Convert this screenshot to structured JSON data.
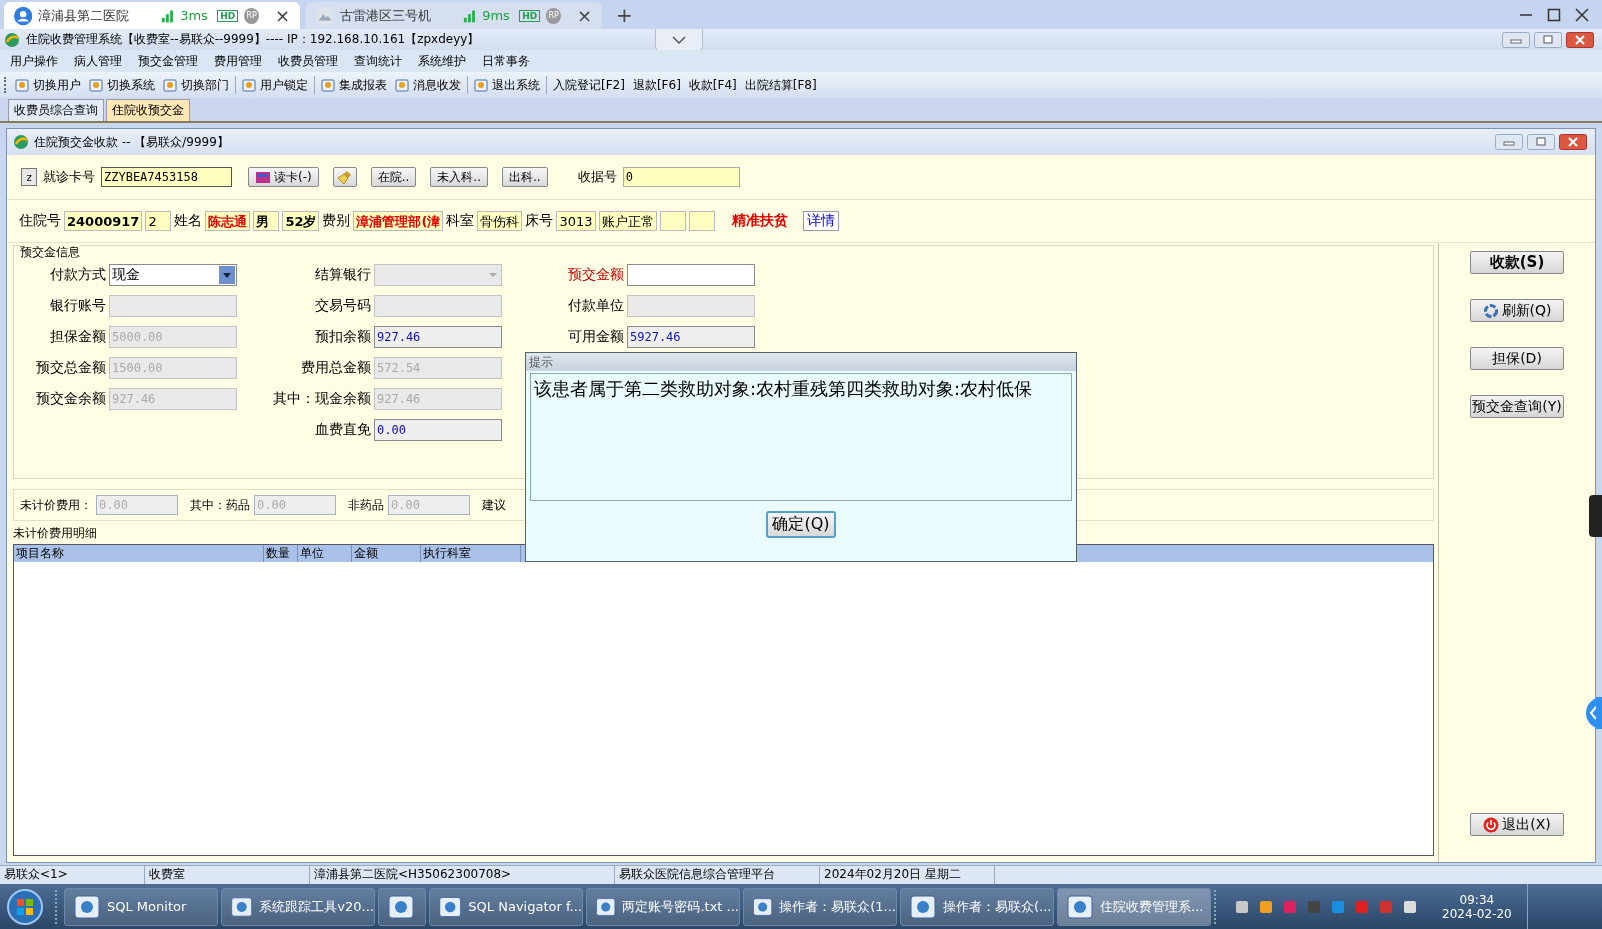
{
  "remote_tabs": [
    {
      "title": "漳浦县第二医院",
      "latency": "3ms",
      "badges": [
        "HD",
        "RP"
      ],
      "close": "×",
      "selected": true
    },
    {
      "title": "古雷港区三号机",
      "latency": "9ms",
      "badges": [
        "HD",
        "RP"
      ],
      "close": "×",
      "selected": false
    }
  ],
  "new_tab": "+",
  "app_title": "住院收费管理系统【收费室--易联众--9999】---- IP：192.168.10.161【zpxdeyy】",
  "menu": [
    "用户操作",
    "病人管理",
    "预交金管理",
    "费用管理",
    "收费员管理",
    "查询统计",
    "系统维护",
    "日常事务"
  ],
  "toolbar": [
    {
      "label": "切换用户",
      "kind": "icon"
    },
    {
      "label": "切换系统",
      "kind": "icon"
    },
    {
      "label": "切换部门",
      "kind": "icon"
    },
    {
      "label": "用户锁定",
      "kind": "icon"
    },
    {
      "label": "集成报表",
      "kind": "icon"
    },
    {
      "label": "消息收发",
      "kind": "icon"
    },
    {
      "label": "退出系统",
      "kind": "icon"
    },
    {
      "label": "入院登记[F2]",
      "kind": "text"
    },
    {
      "label": "退款[F6]",
      "kind": "text"
    },
    {
      "label": "收款[F4]",
      "kind": "text"
    },
    {
      "label": "出院结算[F8]",
      "kind": "text"
    }
  ],
  "doc_tabs": [
    {
      "label": "收费员综合查询",
      "selected": false
    },
    {
      "label": "住院收预交金",
      "selected": true
    }
  ],
  "window": {
    "title": "住院预交金收款 -- 【易联众/9999】"
  },
  "card_row": {
    "z_button": "z",
    "card_label": "就诊卡号",
    "card_value": "ZZYBEA7453158",
    "read_button": "读卡(-)",
    "buttons": [
      "在院..",
      "未入科..",
      "出科.."
    ],
    "receipt_label": "收据号",
    "receipt_value": "0"
  },
  "patient_row": [
    {
      "kind": "label",
      "text": "住院号"
    },
    {
      "kind": "field",
      "text": "24000917",
      "bold": true,
      "highlight": false
    },
    {
      "kind": "field",
      "text": "2",
      "bold": false,
      "highlight": false
    },
    {
      "kind": "label",
      "text": "姓名"
    },
    {
      "kind": "field",
      "text": "陈志通",
      "bold": true,
      "highlight": true
    },
    {
      "kind": "field",
      "text": "男",
      "bold": true,
      "highlight": false
    },
    {
      "kind": "field",
      "text": "52岁",
      "bold": true,
      "highlight": false
    },
    {
      "kind": "label",
      "text": "费别"
    },
    {
      "kind": "field",
      "text": "漳浦管理部(湋",
      "bold": true,
      "highlight": true
    },
    {
      "kind": "label",
      "text": "科室"
    },
    {
      "kind": "field",
      "text": "骨伤科",
      "bold": false,
      "highlight": false
    },
    {
      "kind": "label",
      "text": "床号"
    },
    {
      "kind": "field",
      "text": "3013",
      "bold": false,
      "highlight": false
    },
    {
      "kind": "field",
      "text": "账户正常",
      "bold": false,
      "highlight": false
    },
    {
      "kind": "field"
    },
    {
      "kind": "field"
    },
    {
      "kind": "alert",
      "text": "精准扶贫"
    },
    {
      "kind": "link",
      "text": "详情"
    }
  ],
  "deposit_group": {
    "title": "预交金信息",
    "columns": [
      [
        {
          "label": "付款方式",
          "value": "现金",
          "kind": "combo",
          "editable": true,
          "disabled": false
        },
        {
          "label": "银行账号",
          "kind": "text",
          "editable": false,
          "disabled": true
        },
        {
          "label": "担保金额",
          "value": "5000.00",
          "kind": "text",
          "editable": false,
          "disabled": true
        },
        {
          "label": "预交总金额",
          "value": "1500.00",
          "kind": "text",
          "editable": false,
          "disabled": true
        },
        {
          "label": "预交金余额",
          "value": "927.46",
          "kind": "text",
          "editable": false,
          "disabled": true
        }
      ],
      [
        {
          "label": "结算银行",
          "kind": "combo",
          "editable": false,
          "disabled": true
        },
        {
          "label": "交易号码",
          "kind": "text",
          "editable": false,
          "disabled": true
        },
        {
          "label": "预扣余额",
          "value": "927.46",
          "kind": "text",
          "editable": false,
          "disabled": false
        },
        {
          "label": "费用总金额",
          "value": "572.54",
          "kind": "text",
          "editable": false,
          "disabled": true
        },
        {
          "label": "其中：现金余额",
          "value": "927.46",
          "kind": "text",
          "editable": false,
          "disabled": true
        },
        {
          "label": "血费直免",
          "value": "0.00",
          "kind": "text",
          "editable": false,
          "disabled": false
        }
      ],
      [
        {
          "label": "预交金额",
          "kind": "text",
          "editable": true,
          "disabled": false,
          "required": true
        },
        {
          "label": "付款单位",
          "kind": "text",
          "editable": false,
          "disabled": true
        },
        {
          "label": "可用金额",
          "value": "5927.46",
          "kind": "text",
          "editable": false,
          "disabled": false
        }
      ]
    ]
  },
  "unpriced": [
    {
      "label": "未计价费用：",
      "value": "0.00"
    },
    {
      "label": "其中：药品",
      "value": "0.00"
    },
    {
      "label": "非药品",
      "value": "0.00"
    }
  ],
  "unpriced_note": "建议",
  "detail_title": "未计价费用明细",
  "table": {
    "columns": [
      "项目名称",
      "数量",
      "单位",
      "金额",
      "执行科室"
    ]
  },
  "side_buttons": [
    {
      "label": "收款(S)",
      "kind": "bold"
    },
    {
      "label": "刷新(Q)",
      "kind": "icon"
    },
    {
      "label": "担保(D)",
      "kind": "plain"
    },
    {
      "label": "预交金查询(Y)",
      "kind": "plain"
    }
  ],
  "exit_button": "退出(X)",
  "dialog": {
    "title": "提示",
    "message": "该患者属于第二类救助对象:农村重残第四类救助对象:农村低保",
    "button": "确定(Q)"
  },
  "status_bar": [
    "易联众<1>",
    "收费室",
    "漳浦县第二医院<H35062300708>",
    "易联众医院信息综合管理平台",
    "2024年02月20日 星期二"
  ],
  "taskbar": {
    "items": [
      {
        "label": "SQL Monitor",
        "selected": false
      },
      {
        "label": "系统跟踪工具v20...",
        "selected": false
      },
      {
        "selected": false
      },
      {
        "label": "SQL Navigator f...",
        "selected": false
      },
      {
        "label": "两定账号密码.txt ...",
        "selected": false
      },
      {
        "label": "操作者：易联众(1...",
        "selected": false
      },
      {
        "label": "操作者：易联众(...",
        "selected": false
      },
      {
        "label": "住院收费管理系...",
        "selected": true
      }
    ],
    "time": "09:34",
    "date": "2024-02-20"
  }
}
